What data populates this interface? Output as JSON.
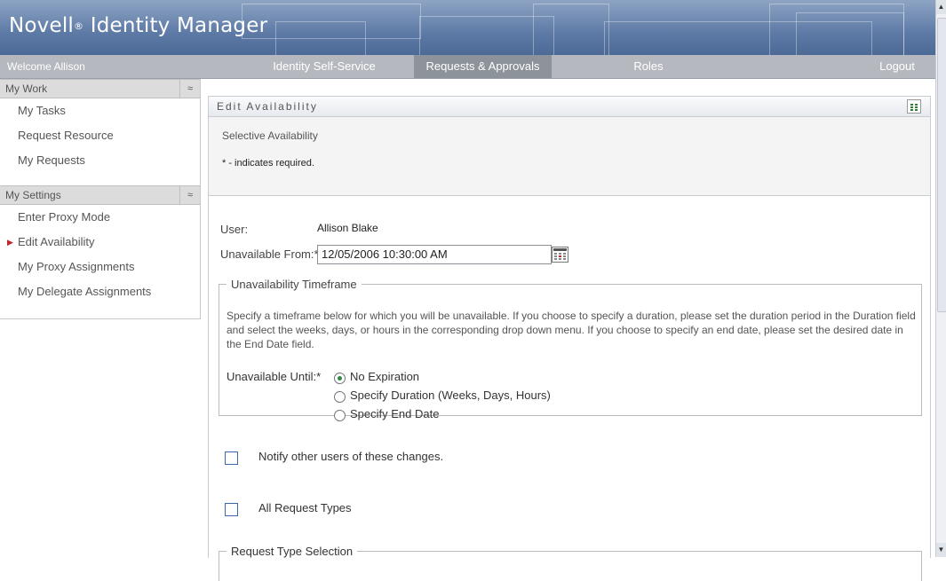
{
  "header": {
    "logo_text": "Novell",
    "logo_mark": "®",
    "logo_rest": "Identity Manager"
  },
  "navbar": {
    "welcome": "Welcome Allison",
    "tabs": [
      "Identity Self-Service",
      "Requests & Approvals",
      "Roles"
    ],
    "active_tab": "Requests & Approvals",
    "logout": "Logout"
  },
  "sidebar": {
    "sections": [
      {
        "title": "My Work",
        "items": [
          "My Tasks",
          "Request Resource",
          "My Requests"
        ]
      },
      {
        "title": "My Settings",
        "items": [
          "Enter Proxy Mode",
          "Edit Availability",
          "My Proxy Assignments",
          "My Delegate Assignments"
        ]
      }
    ],
    "selected_item": "Edit Availability",
    "collapse_glyph": "≈"
  },
  "panel": {
    "title": "Edit Availability",
    "subtitle": "Selective Availability",
    "required_note": "* - indicates required.",
    "user_label": "User:",
    "user_value": "Allison Blake",
    "from_label": "Unavailable From:*",
    "from_value": "12/05/2006 10:30:00 AM",
    "timeframe": {
      "legend": "Unavailability Timeframe",
      "description": "Specify a timeframe below for which you will be unavailable. If you choose to specify a duration, please set the duration period in the Duration field and select the weeks, days, or hours in the corresponding drop down menu. If you choose to specify an end date, please set the desired date in the End Date field.",
      "until_label": "Unavailable Until:*",
      "options": [
        "No Expiration",
        "Specify Duration (Weeks, Days, Hours)",
        "Specify End Date"
      ],
      "selected": "No Expiration"
    },
    "notify_label": "Notify other users of these changes.",
    "all_types_label": "All Request Types",
    "request_type_legend": "Request Type Selection"
  },
  "colors": {
    "header_blue": "#5d7aa6",
    "nav_gray": "#b5b9bf",
    "radio_selected": "#2e8b3e",
    "selected_marker": "#c0262c"
  }
}
